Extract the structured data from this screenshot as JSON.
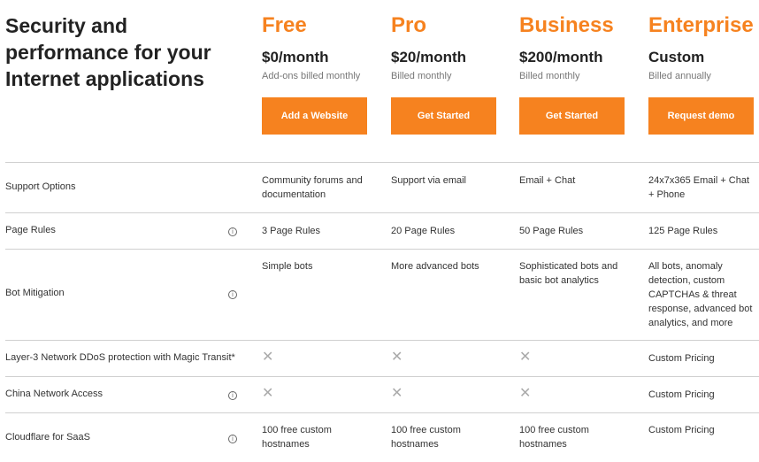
{
  "headline": "Security and performance for your Internet applications",
  "plans": [
    {
      "name": "Free",
      "price": "$0/month",
      "billing": "Add-ons billed monthly",
      "cta": "Add a Website"
    },
    {
      "name": "Pro",
      "price": "$20/month",
      "billing": "Billed monthly",
      "cta": "Get Started"
    },
    {
      "name": "Business",
      "price": "$200/month",
      "billing": "Billed monthly",
      "cta": "Get Started"
    },
    {
      "name": "Enterprise",
      "price": "Custom",
      "billing": "Billed annually",
      "cta": "Request demo"
    }
  ],
  "features": [
    {
      "label": "Support Options",
      "info": false,
      "values": [
        "Community forums and documentation",
        "Support via email",
        "Email + Chat",
        "24x7x365 Email + Chat + Phone"
      ]
    },
    {
      "label": "Page Rules",
      "info": true,
      "values": [
        "3 Page Rules",
        "20 Page Rules",
        "50 Page Rules",
        "125 Page Rules"
      ]
    },
    {
      "label": "Bot Mitigation",
      "info": true,
      "values": [
        "Simple bots",
        "More advanced bots",
        "Sophisticated bots and basic bot analytics",
        "All bots, anomaly detection, custom CAPTCHAs & threat response, advanced bot analytics, and more"
      ]
    },
    {
      "label": "Layer-3 Network DDoS protection with Magic Transit*",
      "info": false,
      "values": [
        "✕",
        "✕",
        "✕",
        "Custom Pricing"
      ]
    },
    {
      "label": "China Network Access",
      "info": true,
      "values": [
        "✕",
        "✕",
        "✕",
        "Custom Pricing"
      ]
    },
    {
      "label": "Cloudflare for SaaS",
      "info": true,
      "values": [
        "100 free custom hostnames",
        "100 free custom hostnames",
        "100 free custom hostnames",
        "Custom Pricing"
      ]
    }
  ],
  "info_icon_glyph": "i",
  "colors": {
    "accent": "#f6821f"
  }
}
